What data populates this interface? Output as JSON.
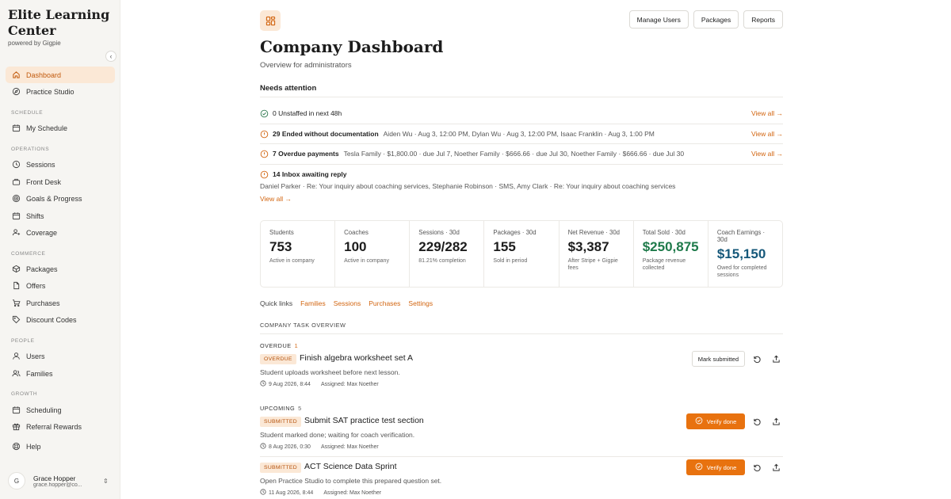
{
  "brand": {
    "name": "Elite Learning Center",
    "sub": "powered by Gigpie"
  },
  "colors": {
    "accent": "#e8720f",
    "accent_soft": "#fbe8d6",
    "link": "#d26510",
    "green": "#1e7a4a",
    "blue": "#15587a"
  },
  "sidebar": {
    "items": [
      {
        "label": "Dashboard",
        "icon": "home-icon",
        "active": true
      },
      {
        "label": "Practice Studio",
        "icon": "compass-icon"
      },
      {
        "label": "My Schedule",
        "icon": "calendar-icon"
      },
      {
        "label": "Sessions",
        "icon": "clock-icon"
      },
      {
        "label": "Front Desk",
        "icon": "desk-icon"
      },
      {
        "label": "Goals & Progress",
        "icon": "target-icon"
      },
      {
        "label": "Shifts",
        "icon": "calendar-icon"
      },
      {
        "label": "Coverage",
        "icon": "user-swap-icon"
      },
      {
        "label": "Packages",
        "icon": "package-icon"
      },
      {
        "label": "Offers",
        "icon": "document-icon"
      },
      {
        "label": "Purchases",
        "icon": "cart-icon"
      },
      {
        "label": "Discount Codes",
        "icon": "tag-icon"
      },
      {
        "label": "Users",
        "icon": "user-icon"
      },
      {
        "label": "Families",
        "icon": "users-icon"
      },
      {
        "label": "Scheduling",
        "icon": "calendar-icon"
      },
      {
        "label": "Referral Rewards",
        "icon": "gift-icon"
      },
      {
        "label": "Help",
        "icon": "help-icon"
      }
    ],
    "sections": {
      "schedule": "SCHEDULE",
      "operations": "OPERATIONS",
      "commerce": "COMMERCE",
      "people": "PEOPLE",
      "growth": "GROWTH"
    },
    "user": {
      "initial": "G",
      "name": "Grace Hopper",
      "email": "grace.hopper@co..."
    }
  },
  "header": {
    "buttons": [
      "Manage Users",
      "Packages",
      "Reports"
    ],
    "title": "Company Dashboard",
    "subtitle": "Overview for administrators"
  },
  "attention": {
    "title": "Needs attention",
    "view_all": "View all →",
    "rows": [
      {
        "label": "0 Unstaffed in next 48h",
        "detail": "",
        "status": "ok"
      },
      {
        "label": "29 Ended without documentation",
        "detail": "Aiden Wu · Aug 3, 12:00 PM, Dylan Wu · Aug 3, 12:00 PM, Isaac Franklin · Aug 3, 1:00 PM",
        "status": "warn"
      },
      {
        "label": "7 Overdue payments",
        "detail": "Tesla Family · $1,800.00 · due Jul 7, Noether Family · $666.66 · due Jul 30, Noether Family · $666.66 · due Jul 30",
        "status": "warn"
      },
      {
        "label": "14 Inbox awaiting reply",
        "detail": "Daniel Parker · Re: Your inquiry about coaching services, Stephanie Robinson · SMS, Amy Clark · Re: Your inquiry about coaching services",
        "status": "warn"
      }
    ]
  },
  "stats": [
    {
      "label": "Students",
      "value": "753",
      "sub": "Active in company"
    },
    {
      "label": "Coaches",
      "value": "100",
      "sub": "Active in company"
    },
    {
      "label": "Sessions · 30d",
      "value": "229/282",
      "sub": "81.21% completion"
    },
    {
      "label": "Packages · 30d",
      "value": "155",
      "sub": "Sold in period"
    },
    {
      "label": "Net Revenue · 30d",
      "value": "$3,387",
      "sub": "After Stripe + Gigpie fees"
    },
    {
      "label": "Total Sold · 30d",
      "value": "$250,875",
      "sub": "Package revenue collected",
      "color": "#1e7a4a"
    },
    {
      "label": "Coach Earnings · 30d",
      "value": "$15,150",
      "sub": "Owed for completed sessions",
      "color": "#15587a"
    }
  ],
  "quick_links": {
    "label": "Quick links",
    "links": [
      "Families",
      "Sessions",
      "Purchases",
      "Settings"
    ]
  },
  "tasks": {
    "title": "COMPANY TASK OVERVIEW",
    "groups": [
      {
        "name": "OVERDUE",
        "count": "1"
      },
      {
        "name": "UPCOMING",
        "count": "5"
      }
    ],
    "items": [
      {
        "badge": "OVERDUE",
        "title": "Finish algebra worksheet set A",
        "desc": "Student uploads worksheet before next lesson.",
        "date": "9 Aug 2026, 8:44",
        "assigned": "Assigned: Max Noether",
        "action": "Mark submitted"
      },
      {
        "badge": "SUBMITTED",
        "title": "Submit SAT practice test section",
        "desc": "Student marked done; waiting for coach verification.",
        "date": "8 Aug 2026, 0:30",
        "assigned": "Assigned: Max Noether",
        "action": "Verify done"
      },
      {
        "badge": "SUBMITTED",
        "title": "ACT Science Data Sprint",
        "desc": "Open Practice Studio to complete this prepared question set.",
        "date": "11 Aug 2026, 8:44",
        "assigned": "Assigned: Max Noether",
        "action": "Verify done"
      }
    ]
  }
}
